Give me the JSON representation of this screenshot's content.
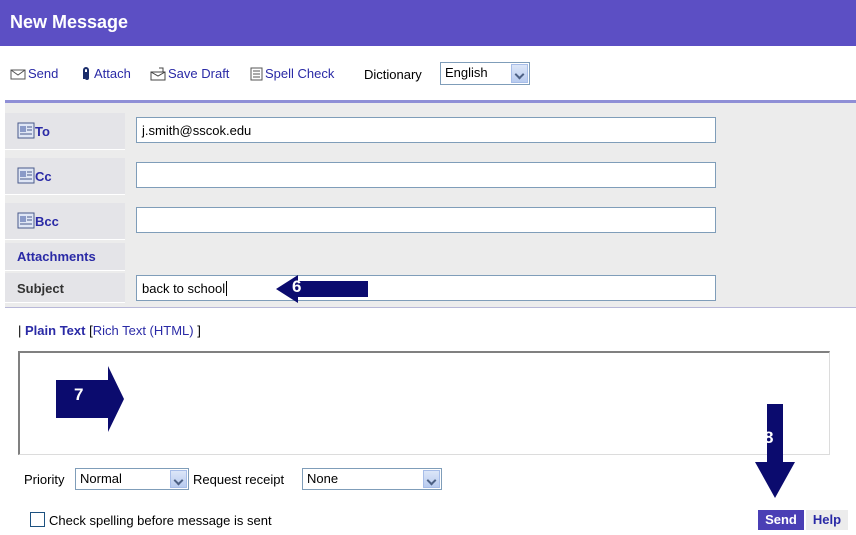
{
  "window": {
    "title": "New Message"
  },
  "toolbar": {
    "send": "Send",
    "attach": "Attach",
    "save_draft": "Save Draft",
    "spell_check": "Spell Check",
    "dictionary_label": "Dictionary",
    "dictionary_value": "English"
  },
  "form": {
    "to_label": "To",
    "to_value": "j.smith@sscok.edu",
    "cc_label": "Cc",
    "cc_value": "",
    "bcc_label": "Bcc",
    "bcc_value": "",
    "attachments_label": "Attachments",
    "subject_label": "Subject",
    "subject_value": "back to school"
  },
  "format": {
    "open_bracket": "|",
    "plain": "Plain Text",
    "separator": "[",
    "rich": "Rich Text (HTML)",
    "close": "]"
  },
  "options": {
    "priority_label": "Priority",
    "priority_value": "Normal",
    "receipt_label": "Request receipt",
    "receipt_value": "None",
    "spellcheck_label": "Check spelling before message is sent"
  },
  "actions": {
    "send": "Send",
    "help": "Help"
  },
  "callouts": {
    "step6": "6",
    "step7": "7",
    "step8": "8"
  },
  "colors": {
    "header": "#5c4fc4",
    "link": "#2a2aa6",
    "callout": "#0b0b6e"
  }
}
